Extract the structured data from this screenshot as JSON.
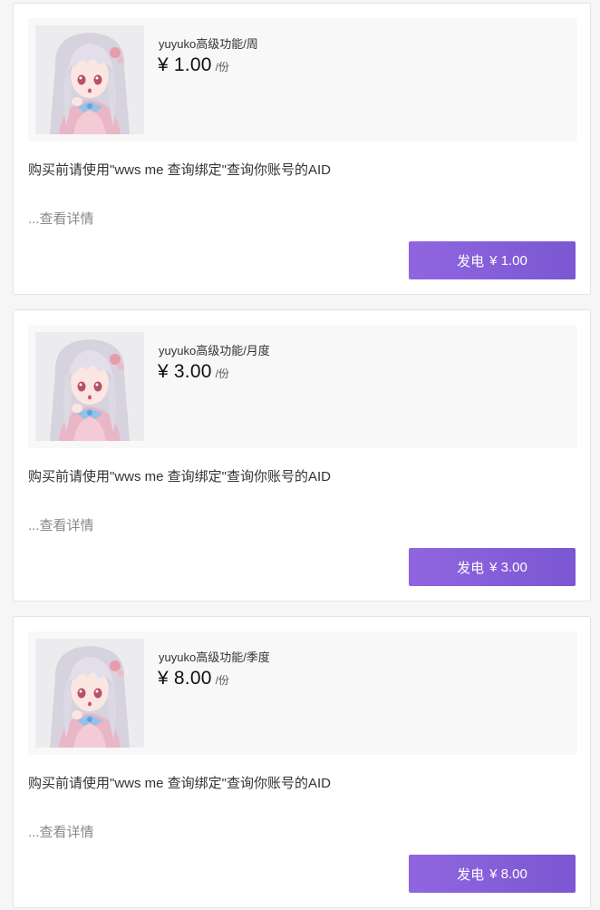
{
  "theme": {
    "accent": "#8460d9",
    "card_bg": "#ffffff",
    "page_bg": "#f6f6f7"
  },
  "items": [
    {
      "name": "yuyuko高级功能/周",
      "price": "¥ 1.00",
      "unit": "/份",
      "description": "购买前请使用\"wws me 查询绑定\"查询你账号的AID",
      "more_label": "...查看详情",
      "buy_label": "发电",
      "buy_price": "¥ 1.00"
    },
    {
      "name": "yuyuko高级功能/月度",
      "price": "¥ 3.00",
      "unit": "/份",
      "description": "购买前请使用\"wws me 查询绑定\"查询你账号的AID",
      "more_label": "...查看详情",
      "buy_label": "发电",
      "buy_price": "¥ 3.00"
    },
    {
      "name": "yuyuko高级功能/季度",
      "price": "¥ 8.00",
      "unit": "/份",
      "description": "购买前请使用\"wws me 查询绑定\"查询你账号的AID",
      "more_label": "...查看详情",
      "buy_label": "发电",
      "buy_price": "¥ 8.00"
    }
  ]
}
